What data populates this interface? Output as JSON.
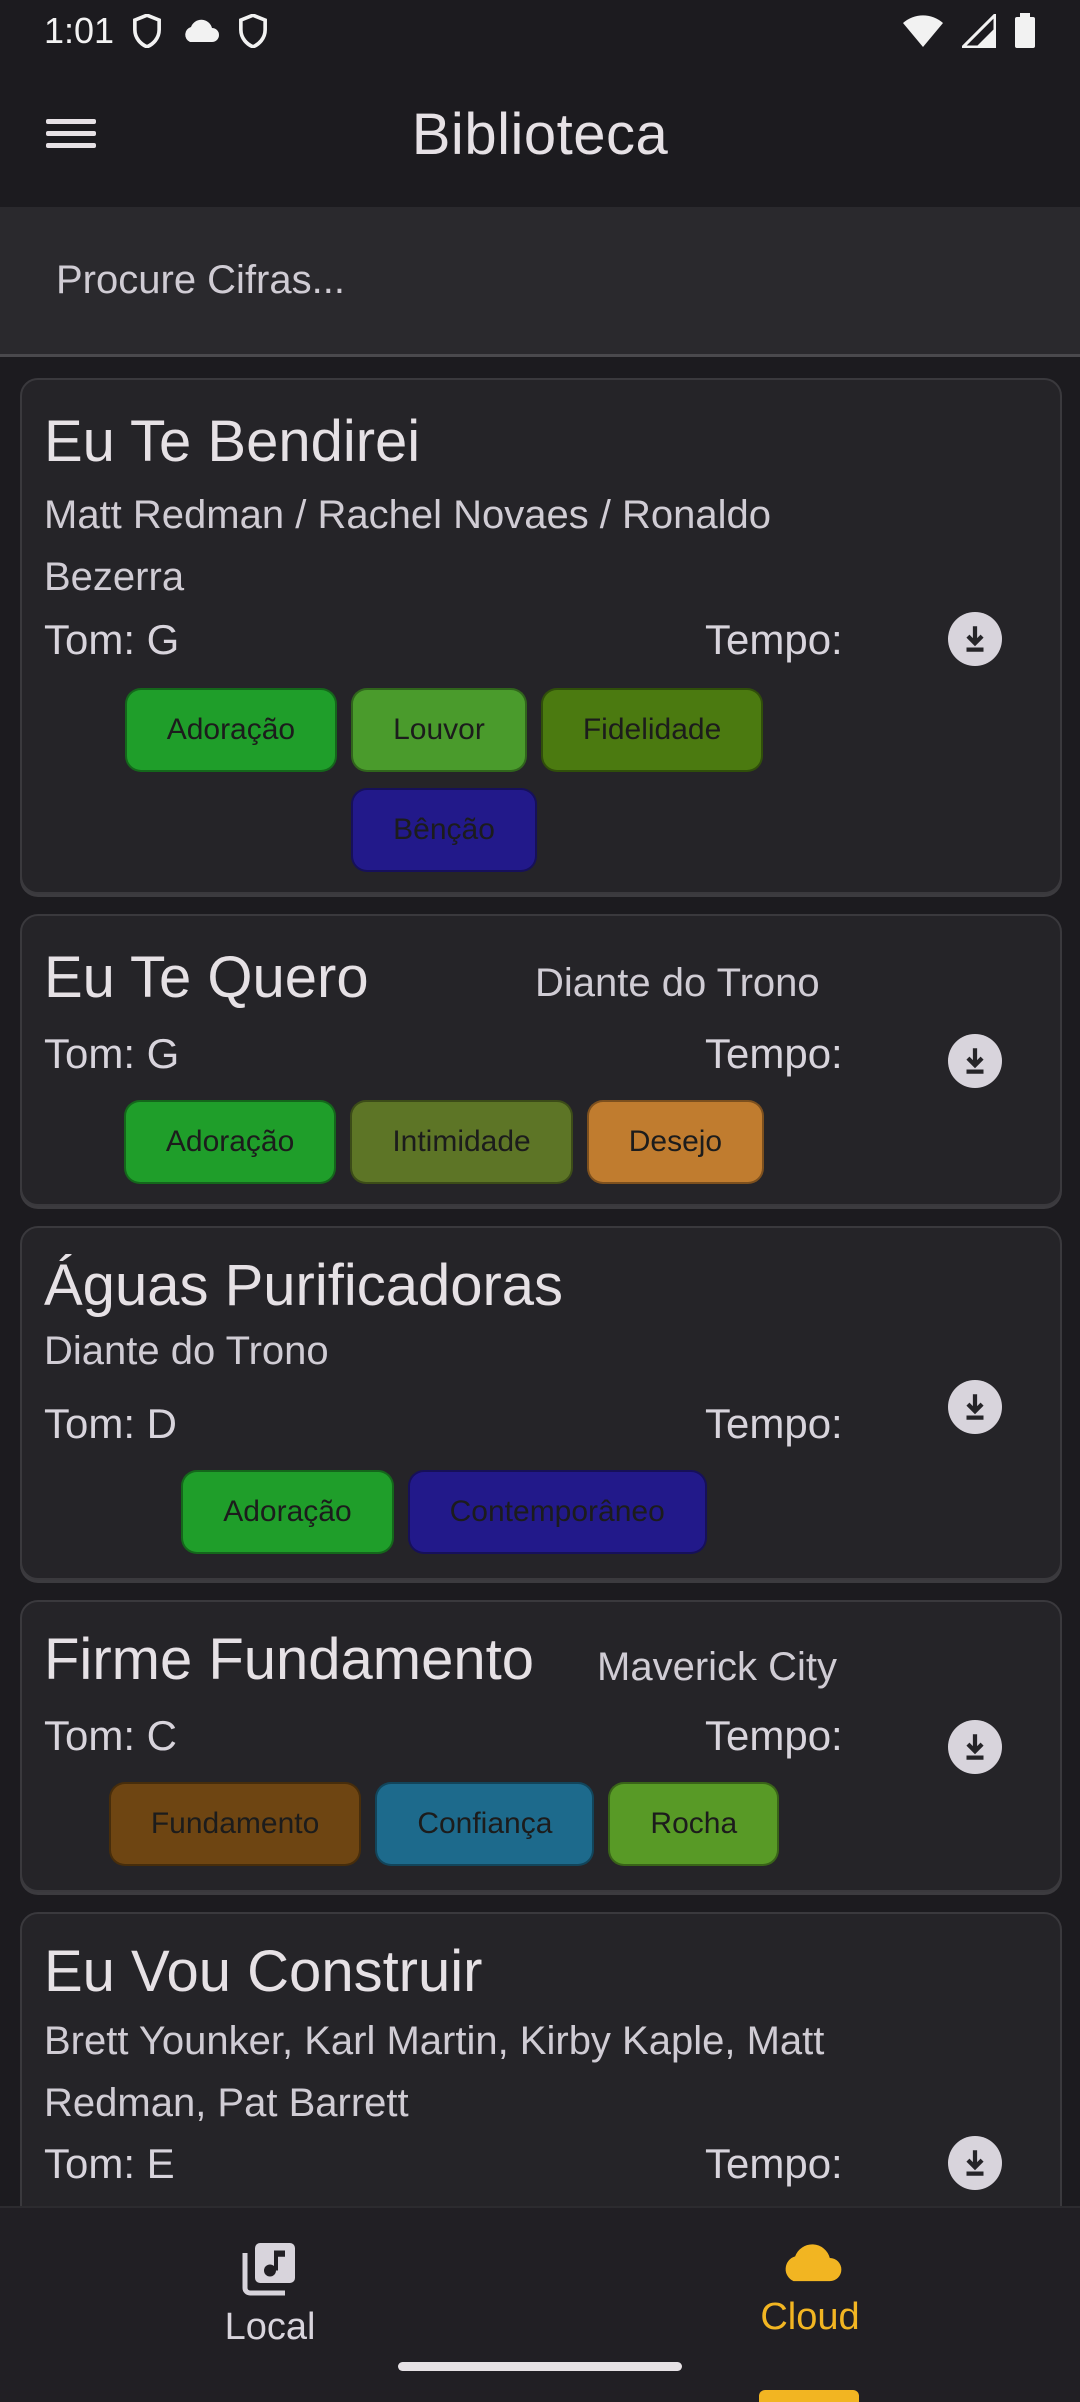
{
  "status": {
    "time": "1:01"
  },
  "appbar": {
    "title": "Biblioteca",
    "menu_icon": "menu-icon"
  },
  "search": {
    "placeholder": "Procure Cifras..."
  },
  "tempo_label": "Tempo:",
  "songs": [
    {
      "title": "Eu Te Bendirei",
      "artist": "Matt Redman / Rachel Novaes / Ronaldo Bezerra",
      "tom": "Tom: G",
      "tags": [
        {
          "label": "Adoração",
          "color": "#1f9e2a"
        },
        {
          "label": "Louvor",
          "color": "#4a9b2c"
        },
        {
          "label": "Fidelidade",
          "color": "#4b7a10"
        },
        {
          "label": "Bênção",
          "color": "#22198a"
        }
      ]
    },
    {
      "title": "Eu Te Quero",
      "artist": "Diante do Trono",
      "tom": "Tom: G",
      "tags": [
        {
          "label": "Adoração",
          "color": "#1f9e2a"
        },
        {
          "label": "Intimidade",
          "color": "#5d7526"
        },
        {
          "label": "Desejo",
          "color": "#c07c2f"
        }
      ]
    },
    {
      "title": "Águas Purificadoras",
      "artist": "Diante do Trono",
      "tom": "Tom: D",
      "tags": [
        {
          "label": "Adoração",
          "color": "#1f9e2a"
        },
        {
          "label": "Contemporâneo",
          "color": "#22198a"
        }
      ]
    },
    {
      "title": "Firme Fundamento",
      "artist": "Maverick City",
      "tom": "Tom: C",
      "tags": [
        {
          "label": "Fundamento",
          "color": "#6e4512"
        },
        {
          "label": "Confiança",
          "color": "#1d6a8c"
        },
        {
          "label": "Rocha",
          "color": "#589a26"
        }
      ]
    },
    {
      "title": "Eu Vou Construir",
      "artist": "Brett Younker, Karl Martin, Kirby Kaple, Matt Redman, Pat Barrett",
      "tom": "Tom: E",
      "tags": []
    }
  ],
  "nav": {
    "local": {
      "label": "Local",
      "icon": "music-library-icon",
      "color": "#d8d4dc"
    },
    "cloud": {
      "label": "Cloud",
      "icon": "cloud-icon",
      "color": "#f2b522",
      "selected": true
    }
  }
}
